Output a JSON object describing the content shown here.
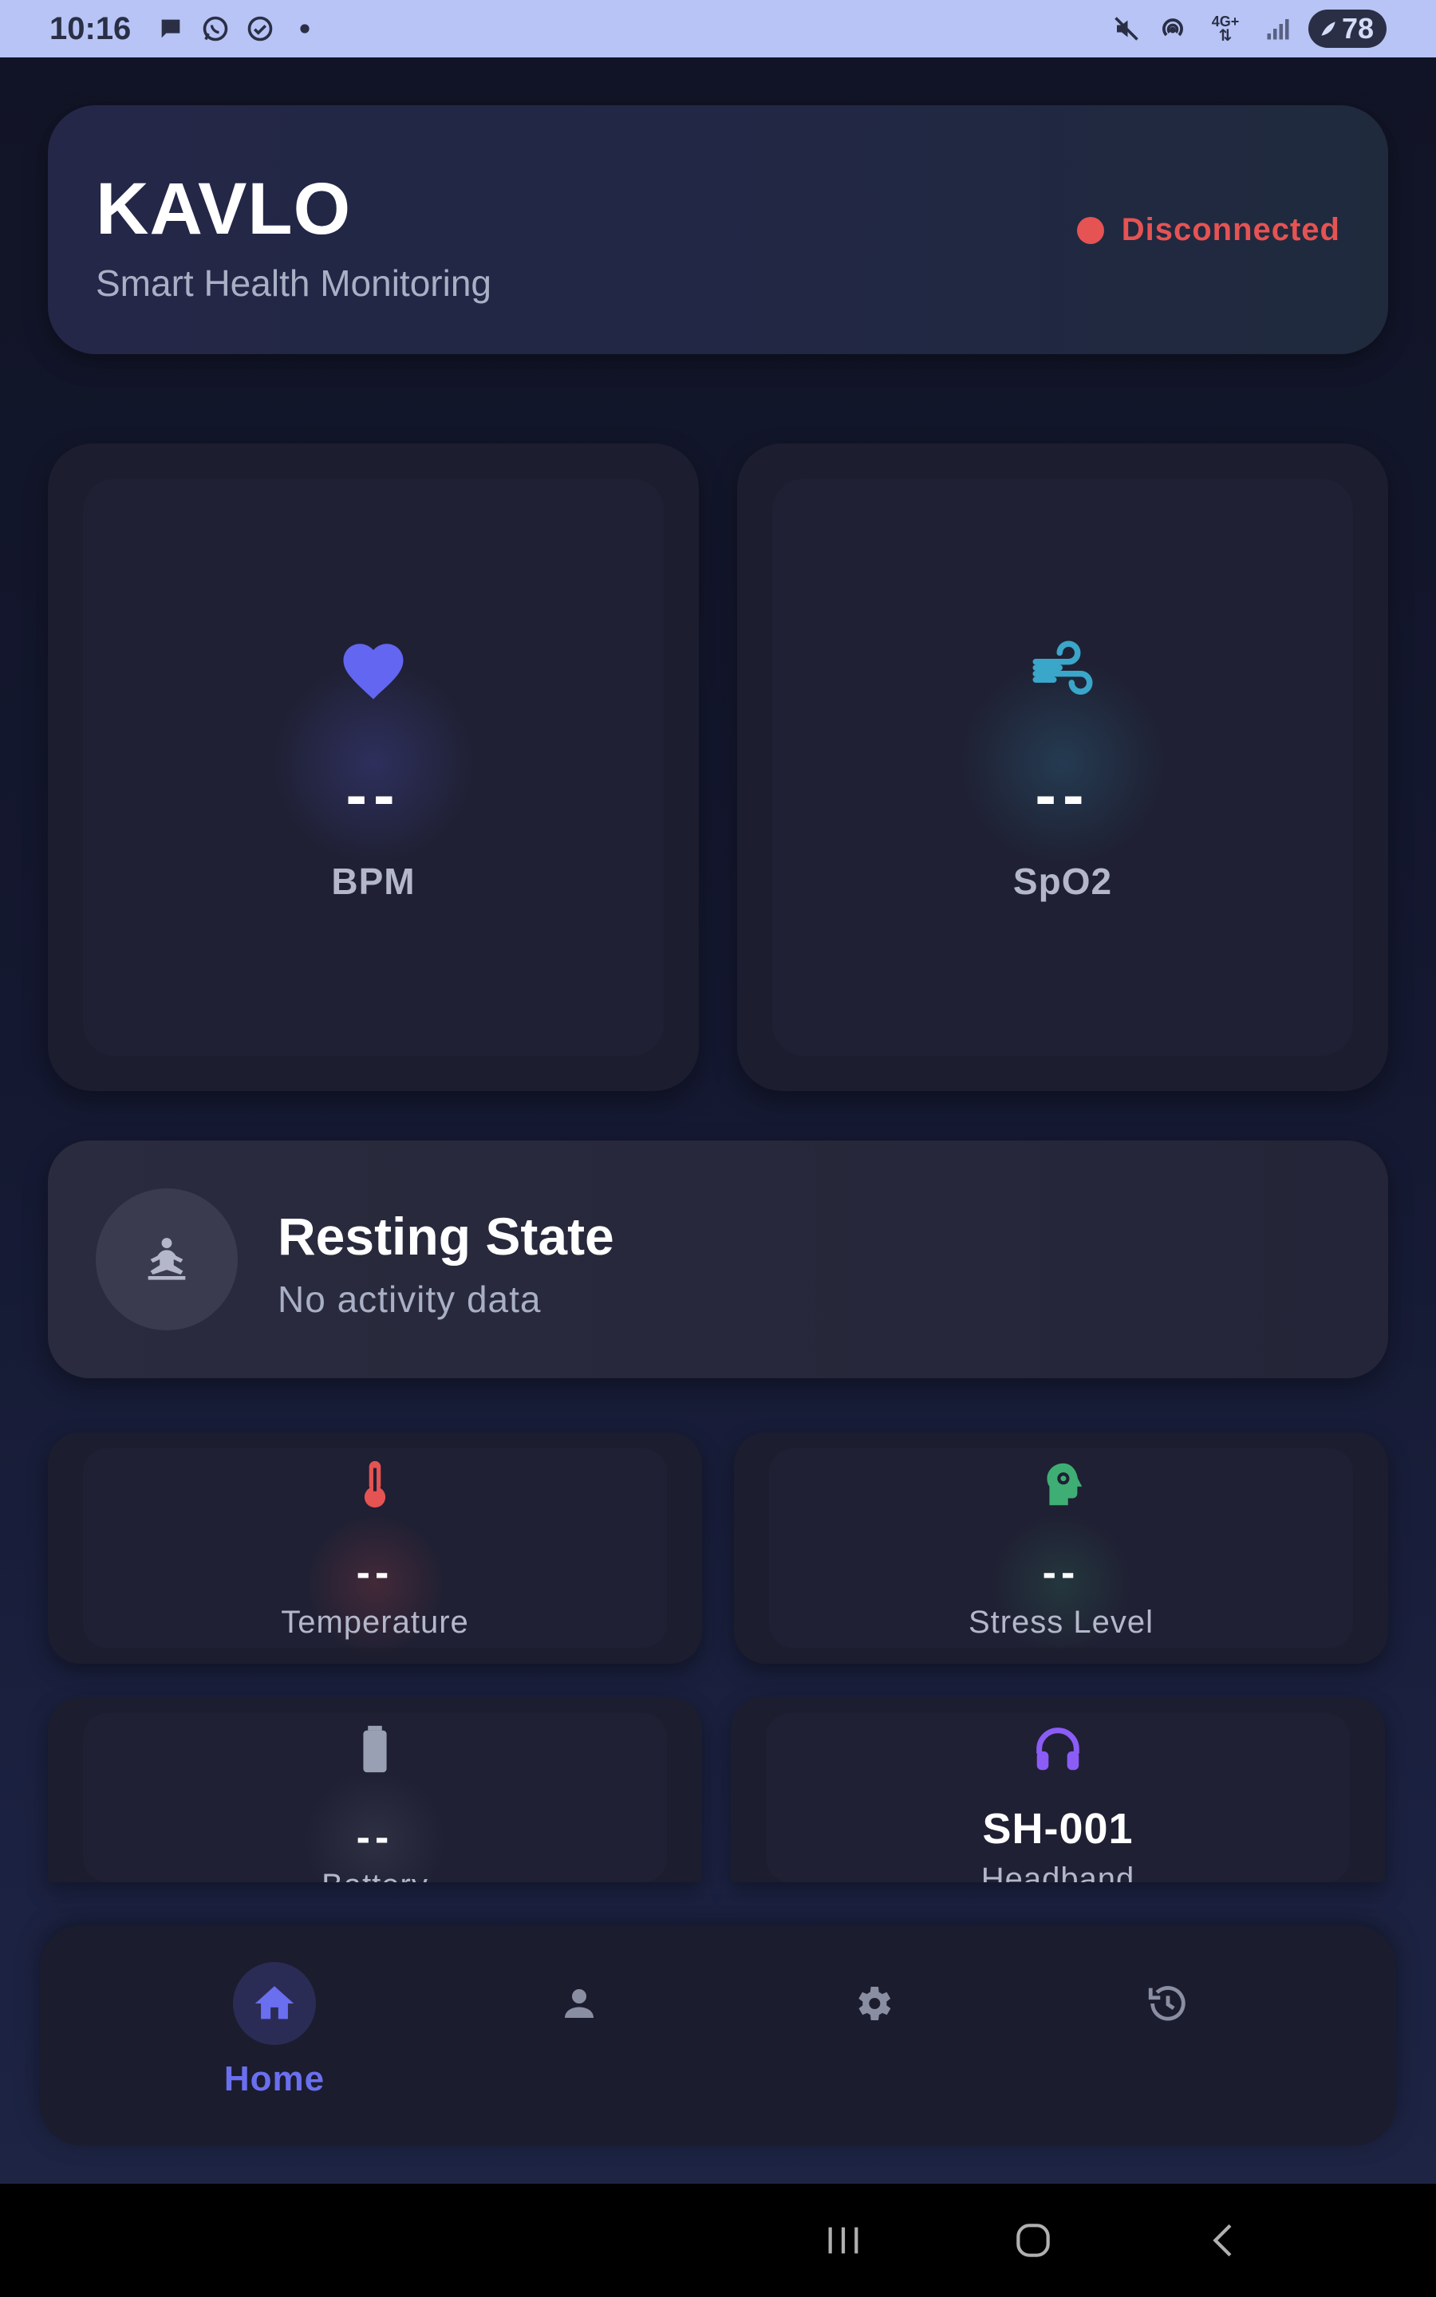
{
  "status_bar": {
    "time": "10:16",
    "network": "4G+",
    "battery": "78",
    "icons": [
      "chat-bubble-icon",
      "whatsapp-icon",
      "check-circle-icon",
      "dot-icon",
      "mute-icon",
      "hotspot-icon",
      "data-arrows-icon",
      "signal-icon",
      "battery-icon"
    ]
  },
  "header": {
    "title": "KAVLO",
    "subtitle": "Smart Health Monitoring",
    "connection_status": "Disconnected",
    "status_color": "#e55353"
  },
  "metrics": [
    {
      "icon": "heart-icon",
      "value": "--",
      "label": "BPM",
      "color": "#6366f1"
    },
    {
      "icon": "wind-icon",
      "value": "--",
      "label": "SpO2",
      "color": "#3aa6c9"
    }
  ],
  "activity": {
    "icon": "meditation-icon",
    "title": "Resting State",
    "subtitle": "No activity data"
  },
  "small_cards": [
    {
      "icon": "thermometer-icon",
      "value": "--",
      "label": "Temperature",
      "color": "#e55353"
    },
    {
      "icon": "head-gear-icon",
      "value": "--",
      "label": "Stress Level",
      "color": "#3fae74"
    },
    {
      "icon": "battery-icon",
      "value": "--",
      "label": "Battery",
      "color": "#9aa0b4"
    },
    {
      "icon": "headphones-icon",
      "value": "SH-001",
      "label": "Headband",
      "color": "#8b5cf6"
    }
  ],
  "bottom_nav": {
    "items": [
      {
        "icon": "home-icon",
        "label": "Home",
        "active": true
      },
      {
        "icon": "person-icon",
        "label": "",
        "active": false
      },
      {
        "icon": "gear-icon",
        "label": "",
        "active": false
      },
      {
        "icon": "history-icon",
        "label": "",
        "active": false
      }
    ],
    "active_color": "#6a6ff0",
    "inactive_color": "#8a8ea3"
  },
  "system_nav": [
    "recents-icon",
    "home-circle-icon",
    "back-icon"
  ]
}
